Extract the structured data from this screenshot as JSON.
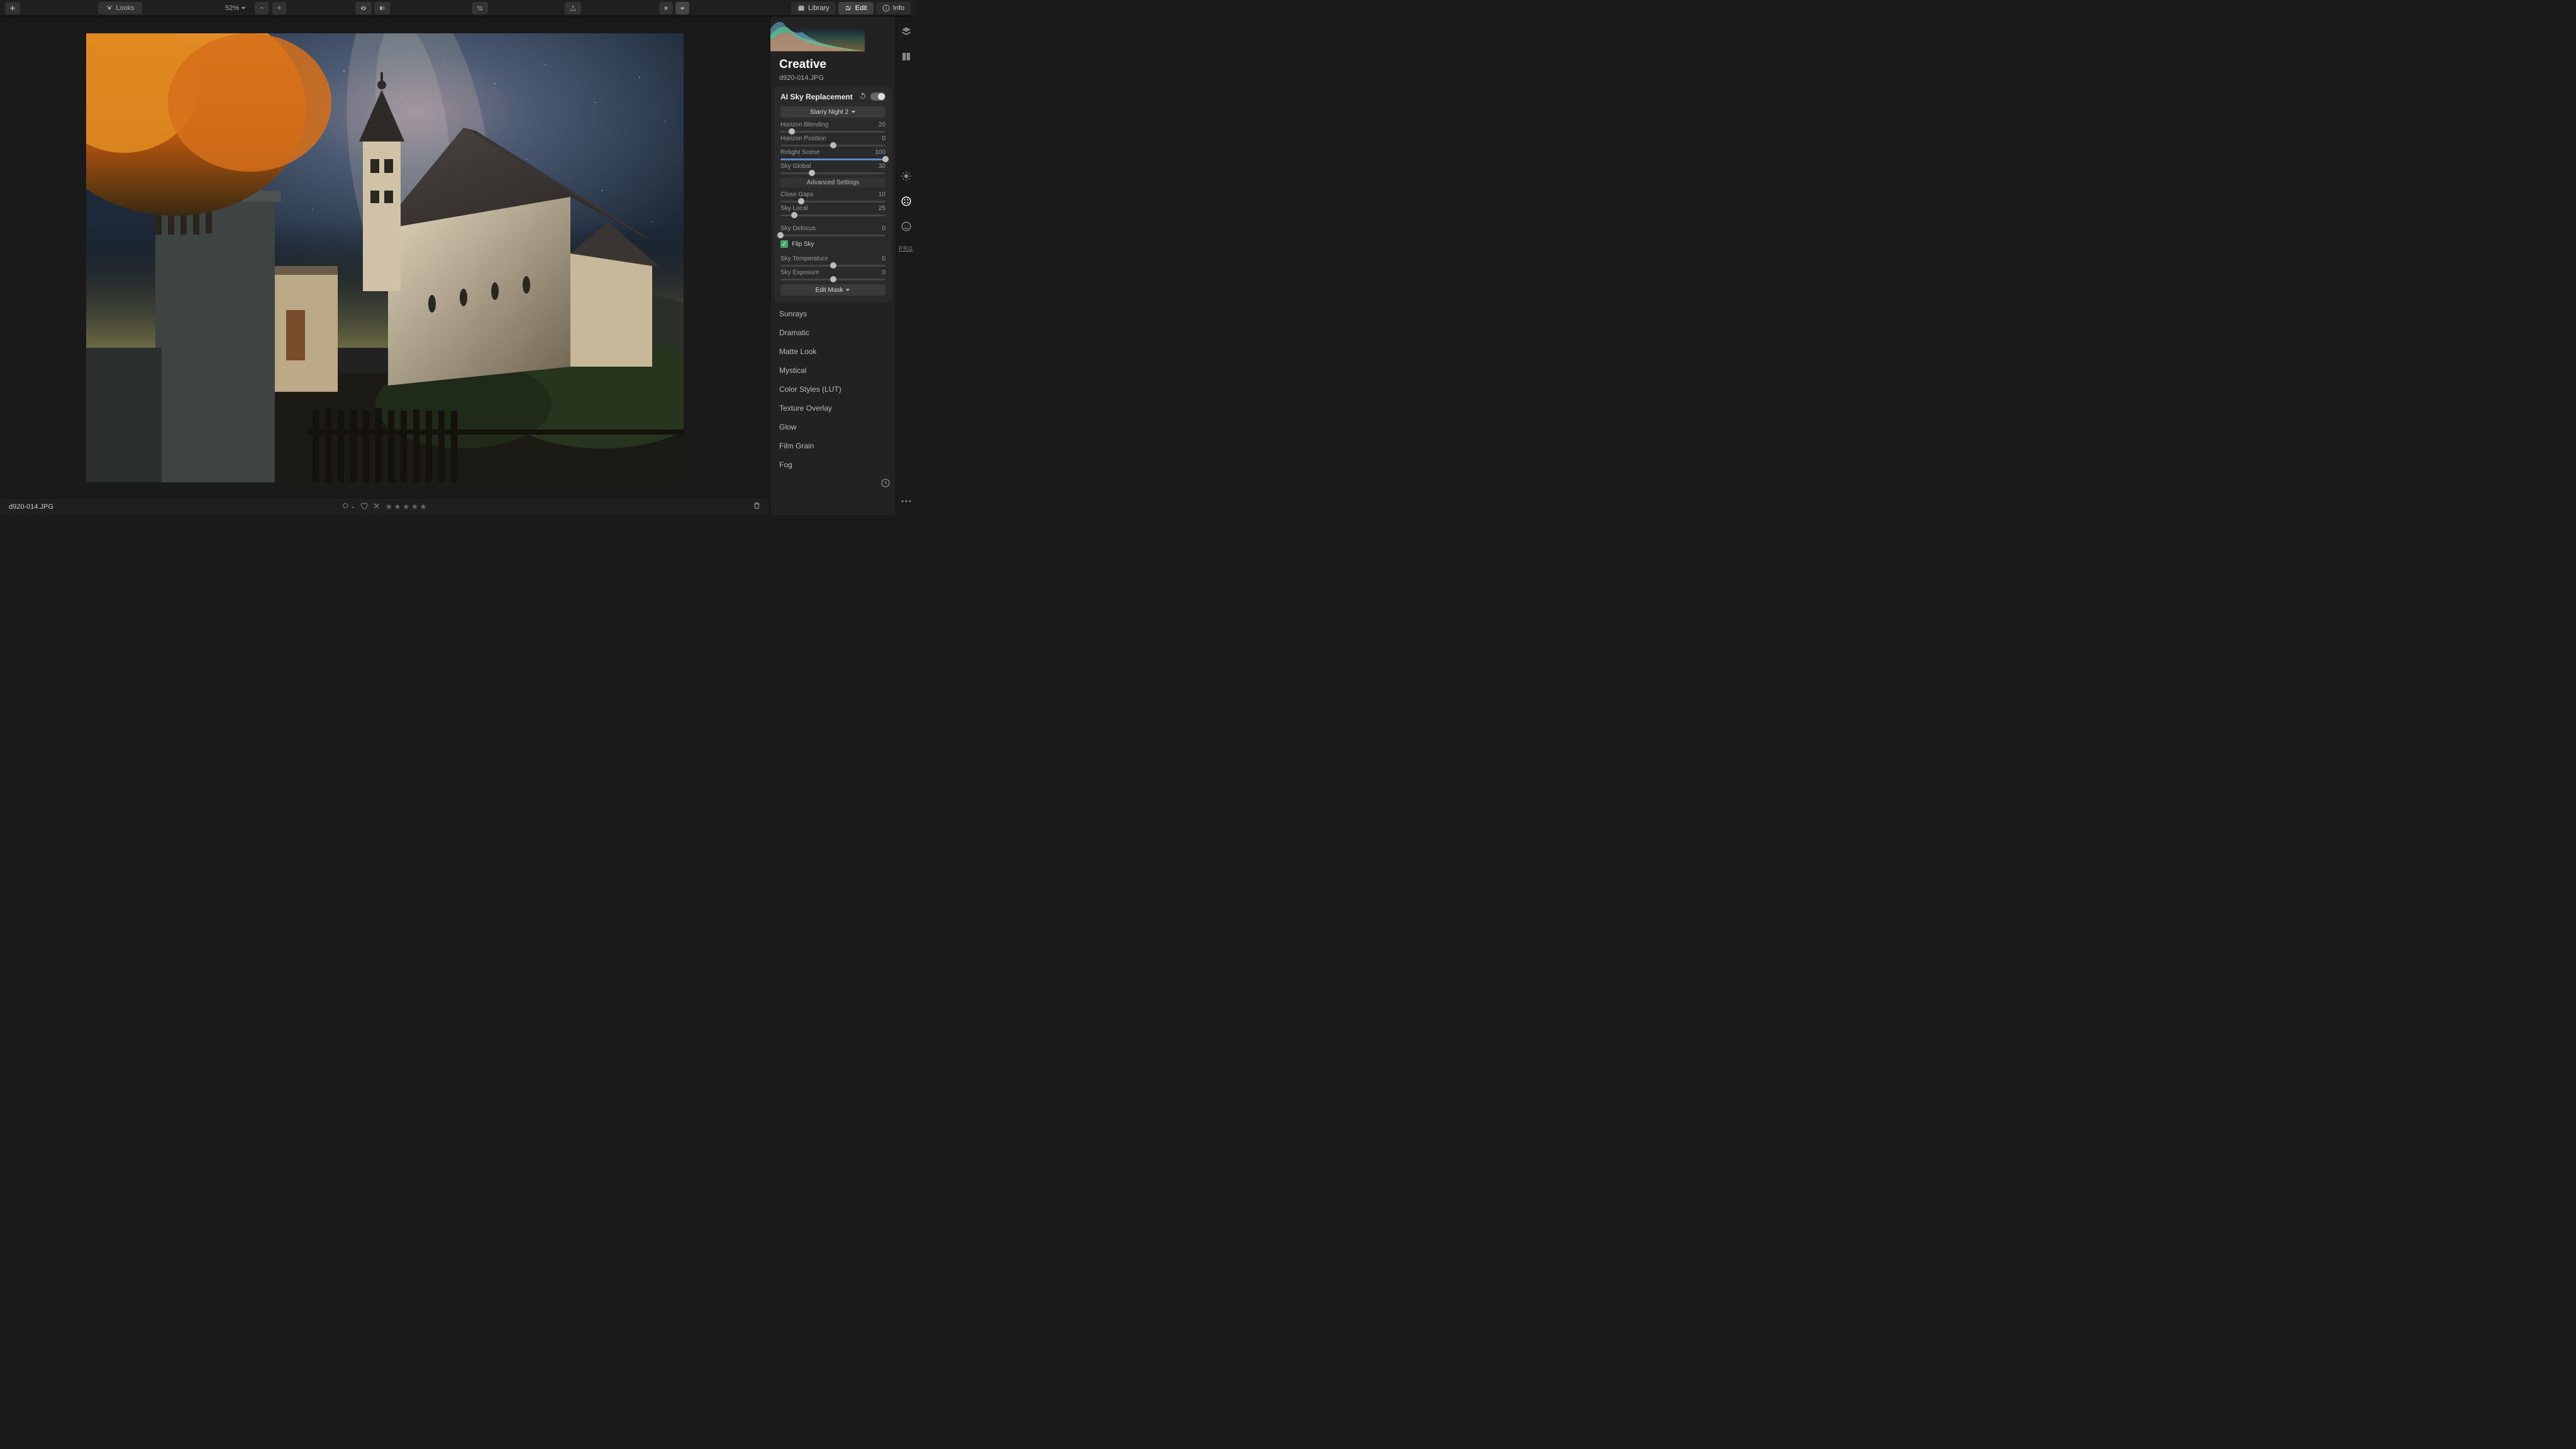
{
  "topbar": {
    "looks_label": "Looks",
    "zoom": "52%",
    "library_label": "Library",
    "edit_label": "Edit",
    "info_label": "Info"
  },
  "panel": {
    "title": "Creative",
    "filename": "d920-014.JPG"
  },
  "sky": {
    "section_title": "AI Sky Replacement",
    "preset": "Starry Night 2",
    "horizon_blending": {
      "label": "Horizon Blending",
      "value": 20
    },
    "horizon_position": {
      "label": "Horizon Position",
      "value": 0
    },
    "relight_scene": {
      "label": "Relight Scene",
      "value": 100
    },
    "sky_global": {
      "label": "Sky Global",
      "value": 30
    },
    "advanced_label": "Advanced Settings",
    "close_gaps": {
      "label": "Close Gaps",
      "value": 10
    },
    "sky_local": {
      "label": "Sky Local",
      "value": 25
    },
    "sky_defocus": {
      "label": "Sky Defocus",
      "value": 0
    },
    "flip_sky_label": "Flip Sky",
    "flip_sky_checked": true,
    "sky_temperature": {
      "label": "Sky Temperature",
      "value": 0
    },
    "sky_exposure": {
      "label": "Sky Exposure",
      "value": 0
    },
    "edit_mask_label": "Edit Mask"
  },
  "filters": [
    "Sunrays",
    "Dramatic",
    "Matte Look",
    "Mystical",
    "Color Styles (LUT)",
    "Texture Overlay",
    "Glow",
    "Film Grain",
    "Fog"
  ],
  "icon_strip": {
    "pro_label": "PRO"
  },
  "bottombar": {
    "filename": "d920-014.JPG"
  }
}
